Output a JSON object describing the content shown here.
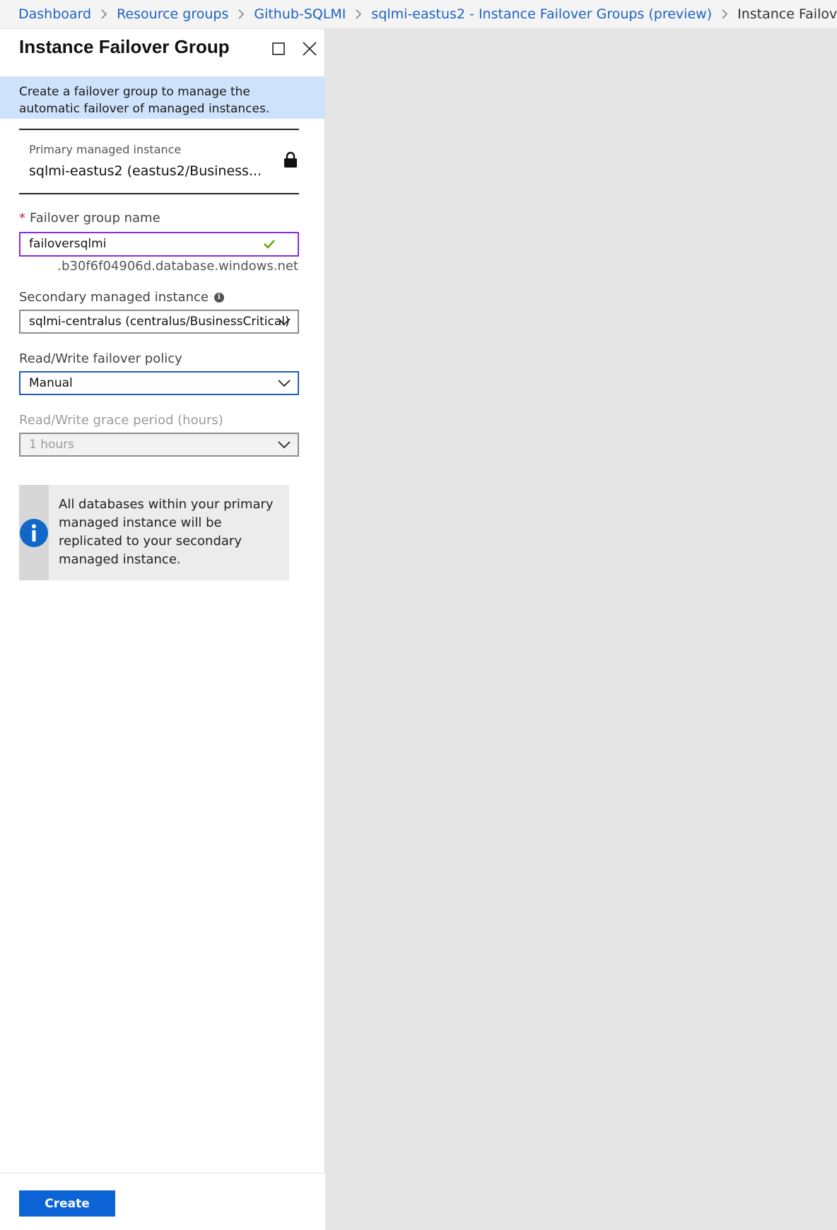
{
  "breadcrumb": {
    "items": [
      "Dashboard",
      "Resource groups",
      "Github-SQLMI",
      "sqlmi-eastus2 - Instance Failover Groups (preview)"
    ],
    "current": "Instance Failover Group"
  },
  "blade": {
    "title": "Instance Failover Group",
    "banner": "Create a failover group to manage the automatic failover of managed instances."
  },
  "primary": {
    "label": "Primary managed instance",
    "value": "sqlmi-eastus2 (eastus2/Business..."
  },
  "failover_name": {
    "label": "Failover group name",
    "required_mark": "*",
    "value": "failoversqlmi",
    "suffix": ".b30f6f04906d.database.windows.net"
  },
  "secondary": {
    "label": "Secondary managed instance",
    "value": "sqlmi-centralus (centralus/BusinessCritical)"
  },
  "policy": {
    "label": "Read/Write failover policy",
    "value": "Manual"
  },
  "grace": {
    "label": "Read/Write grace period (hours)",
    "value": "1 hours"
  },
  "note": {
    "text": "All databases within your primary managed instance will be replicated to your secondary managed instance."
  },
  "footer": {
    "create_label": "Create"
  },
  "colors": {
    "accent": "#0b63d6",
    "link": "#1b62c4",
    "banner": "#cfe2fb",
    "valid_border": "#8a2be2",
    "success": "#5ba300"
  },
  "icons": [
    "chevron-right-icon",
    "maximize-icon",
    "close-icon",
    "lock-icon",
    "checkmark-icon",
    "info-icon",
    "chevron-down-icon"
  ]
}
